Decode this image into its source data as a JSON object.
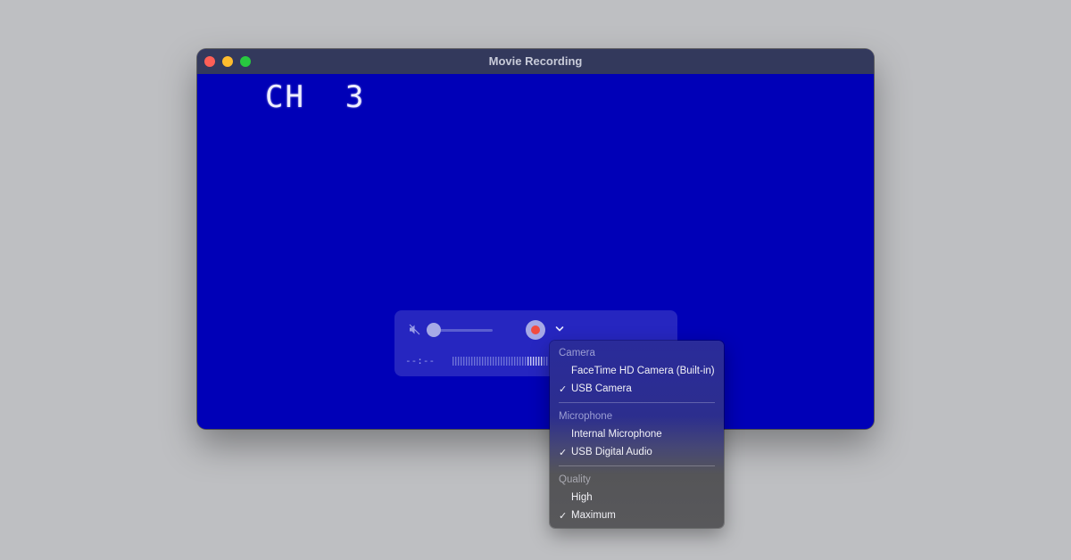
{
  "window": {
    "title": "Movie Recording"
  },
  "video": {
    "osd_text": "CH  3"
  },
  "controls": {
    "timecode": "--:--",
    "volume_level": 0.0
  },
  "menu": {
    "camera": {
      "header": "Camera",
      "items": [
        {
          "label": "FaceTime HD Camera (Built-in)",
          "checked": false
        },
        {
          "label": "USB Camera",
          "checked": true
        }
      ]
    },
    "microphone": {
      "header": "Microphone",
      "items": [
        {
          "label": "Internal Microphone",
          "checked": false
        },
        {
          "label": "USB Digital Audio",
          "checked": true
        }
      ]
    },
    "quality": {
      "header": "Quality",
      "items": [
        {
          "label": "High",
          "checked": false
        },
        {
          "label": "Maximum",
          "checked": true
        }
      ]
    },
    "check_glyph": "✓"
  },
  "colors": {
    "video_background": "#0000b7",
    "record_dot": "#f24b3f"
  }
}
